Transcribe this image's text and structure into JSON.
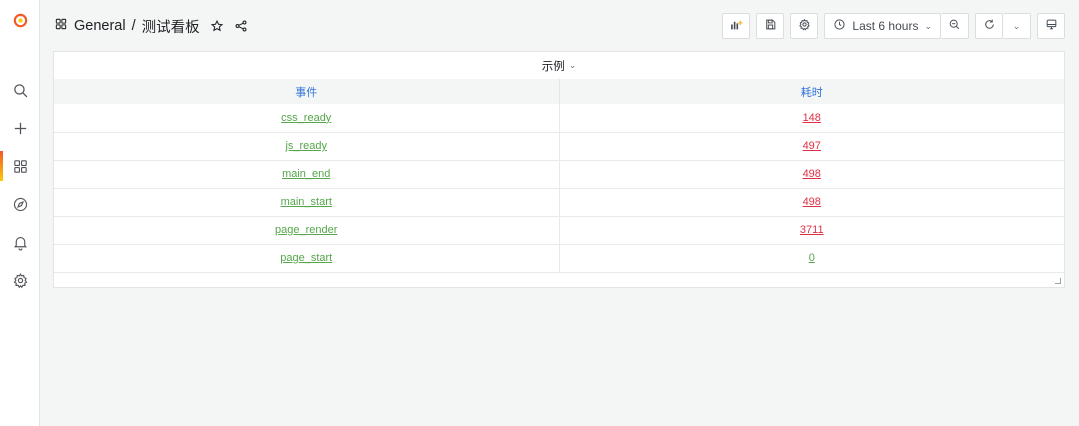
{
  "breadcrumb": {
    "folder": "General",
    "separator": "/",
    "dashboard": "测试看板"
  },
  "toolbar": {
    "time_range": "Last 6 hours"
  },
  "panel": {
    "title": "示例",
    "columns": [
      "事件",
      "耗时"
    ],
    "rows": [
      {
        "event": "css_ready",
        "duration": "148",
        "status": "red"
      },
      {
        "event": "js_ready",
        "duration": "497",
        "status": "red"
      },
      {
        "event": "main_end",
        "duration": "498",
        "status": "red"
      },
      {
        "event": "main_start",
        "duration": "498",
        "status": "red"
      },
      {
        "event": "page_render",
        "duration": "3711",
        "status": "red"
      },
      {
        "event": "page_start",
        "duration": "0",
        "status": "green"
      }
    ]
  },
  "colors": {
    "accent_orange": "#f05a28",
    "header_blue": "#3274d9",
    "event_green": "#56a64b",
    "value_red": "#e02f44"
  },
  "icons": [
    "grafana-logo-icon",
    "search-icon",
    "plus-icon",
    "dashboards-icon",
    "explore-icon",
    "bell-icon",
    "gear-icon",
    "star-icon",
    "share-icon",
    "add-panel-icon",
    "save-icon",
    "clock-icon",
    "zoom-out-icon",
    "refresh-icon",
    "tv-icon"
  ]
}
